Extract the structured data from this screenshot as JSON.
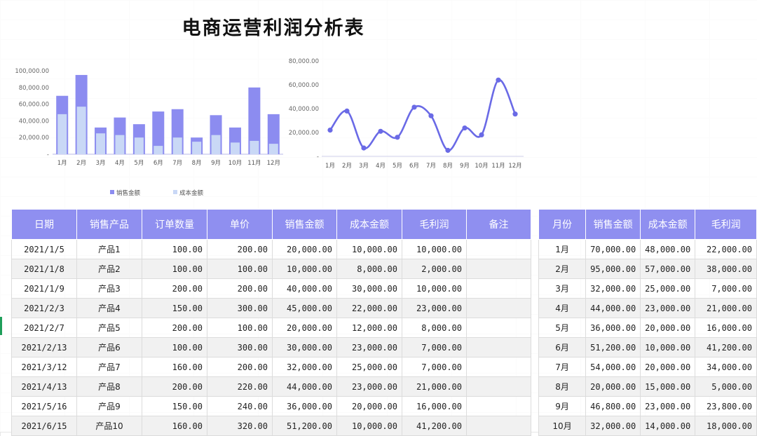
{
  "title": "电商运营利润分析表",
  "colors": {
    "sales": "#8c8cf0",
    "cost": "#c9d8f6",
    "line": "#6a6ae6",
    "header": "#8f8ff0"
  },
  "chart_data": [
    {
      "type": "bar",
      "categories": [
        "1月",
        "2月",
        "3月",
        "4月",
        "5月",
        "6月",
        "7月",
        "8月",
        "9月",
        "10月",
        "11月",
        "12月"
      ],
      "series": [
        {
          "name": "销售金额",
          "values": [
            70000,
            95000,
            32000,
            44000,
            36000,
            51200,
            54000,
            20000,
            46800,
            32000,
            80000,
            48000
          ]
        },
        {
          "name": "成本金额",
          "values": [
            48000,
            57000,
            25000,
            23000,
            20000,
            10000,
            20000,
            15000,
            23000,
            14000,
            16000,
            12500
          ]
        }
      ],
      "ylim": [
        0,
        100000
      ],
      "yticks": [
        "-",
        "20,000.00",
        "40,000.00",
        "60,000.00",
        "80,000.00",
        "100,000.00"
      ],
      "legend": "bottom"
    },
    {
      "type": "line",
      "categories": [
        "1月",
        "2月",
        "3月",
        "4月",
        "5月",
        "6月",
        "7月",
        "8月",
        "9月",
        "10月",
        "11月",
        "12月"
      ],
      "series": [
        {
          "values": [
            22000,
            38000,
            7000,
            21000,
            16000,
            41200,
            34000,
            5000,
            23800,
            18000,
            64000,
            35500
          ]
        }
      ],
      "ylim": [
        0,
        80000
      ],
      "yticks": [
        "-",
        "20,000.00",
        "40,000.00",
        "60,000.00",
        "80,000.00"
      ]
    }
  ],
  "main_table": {
    "headers": [
      "日期",
      "销售产品",
      "订单数量",
      "单价",
      "销售金额",
      "成本金额",
      "毛利润",
      "备注"
    ],
    "rows": [
      [
        "2021/1/5",
        "产品1",
        "100.00",
        "200.00",
        "20,000.00",
        "10,000.00",
        "10,000.00",
        ""
      ],
      [
        "2021/1/8",
        "产品2",
        "100.00",
        "100.00",
        "10,000.00",
        "8,000.00",
        "2,000.00",
        ""
      ],
      [
        "2021/1/9",
        "产品3",
        "200.00",
        "200.00",
        "40,000.00",
        "30,000.00",
        "10,000.00",
        ""
      ],
      [
        "2021/2/3",
        "产品4",
        "150.00",
        "300.00",
        "45,000.00",
        "22,000.00",
        "23,000.00",
        ""
      ],
      [
        "2021/2/7",
        "产品5",
        "200.00",
        "100.00",
        "20,000.00",
        "12,000.00",
        "8,000.00",
        ""
      ],
      [
        "2021/2/13",
        "产品6",
        "100.00",
        "300.00",
        "30,000.00",
        "23,000.00",
        "7,000.00",
        ""
      ],
      [
        "2021/3/12",
        "产品7",
        "160.00",
        "200.00",
        "32,000.00",
        "25,000.00",
        "7,000.00",
        ""
      ],
      [
        "2021/4/13",
        "产品8",
        "200.00",
        "220.00",
        "44,000.00",
        "23,000.00",
        "21,000.00",
        ""
      ],
      [
        "2021/5/16",
        "产品9",
        "150.00",
        "240.00",
        "36,000.00",
        "20,000.00",
        "16,000.00",
        ""
      ],
      [
        "2021/6/15",
        "产品10",
        "160.00",
        "320.00",
        "51,200.00",
        "10,000.00",
        "41,200.00",
        ""
      ]
    ]
  },
  "month_table": {
    "headers": [
      "月份",
      "销售金额",
      "成本金额",
      "毛利润"
    ],
    "rows": [
      [
        "1月",
        "70,000.00",
        "48,000.00",
        "22,000.00"
      ],
      [
        "2月",
        "95,000.00",
        "57,000.00",
        "38,000.00"
      ],
      [
        "3月",
        "32,000.00",
        "25,000.00",
        "7,000.00"
      ],
      [
        "4月",
        "44,000.00",
        "23,000.00",
        "21,000.00"
      ],
      [
        "5月",
        "36,000.00",
        "20,000.00",
        "16,000.00"
      ],
      [
        "6月",
        "51,200.00",
        "10,000.00",
        "41,200.00"
      ],
      [
        "7月",
        "54,000.00",
        "20,000.00",
        "34,000.00"
      ],
      [
        "8月",
        "20,000.00",
        "15,000.00",
        "5,000.00"
      ],
      [
        "9月",
        "46,800.00",
        "23,000.00",
        "23,800.00"
      ],
      [
        "10月",
        "32,000.00",
        "14,000.00",
        "18,000.00"
      ]
    ]
  }
}
